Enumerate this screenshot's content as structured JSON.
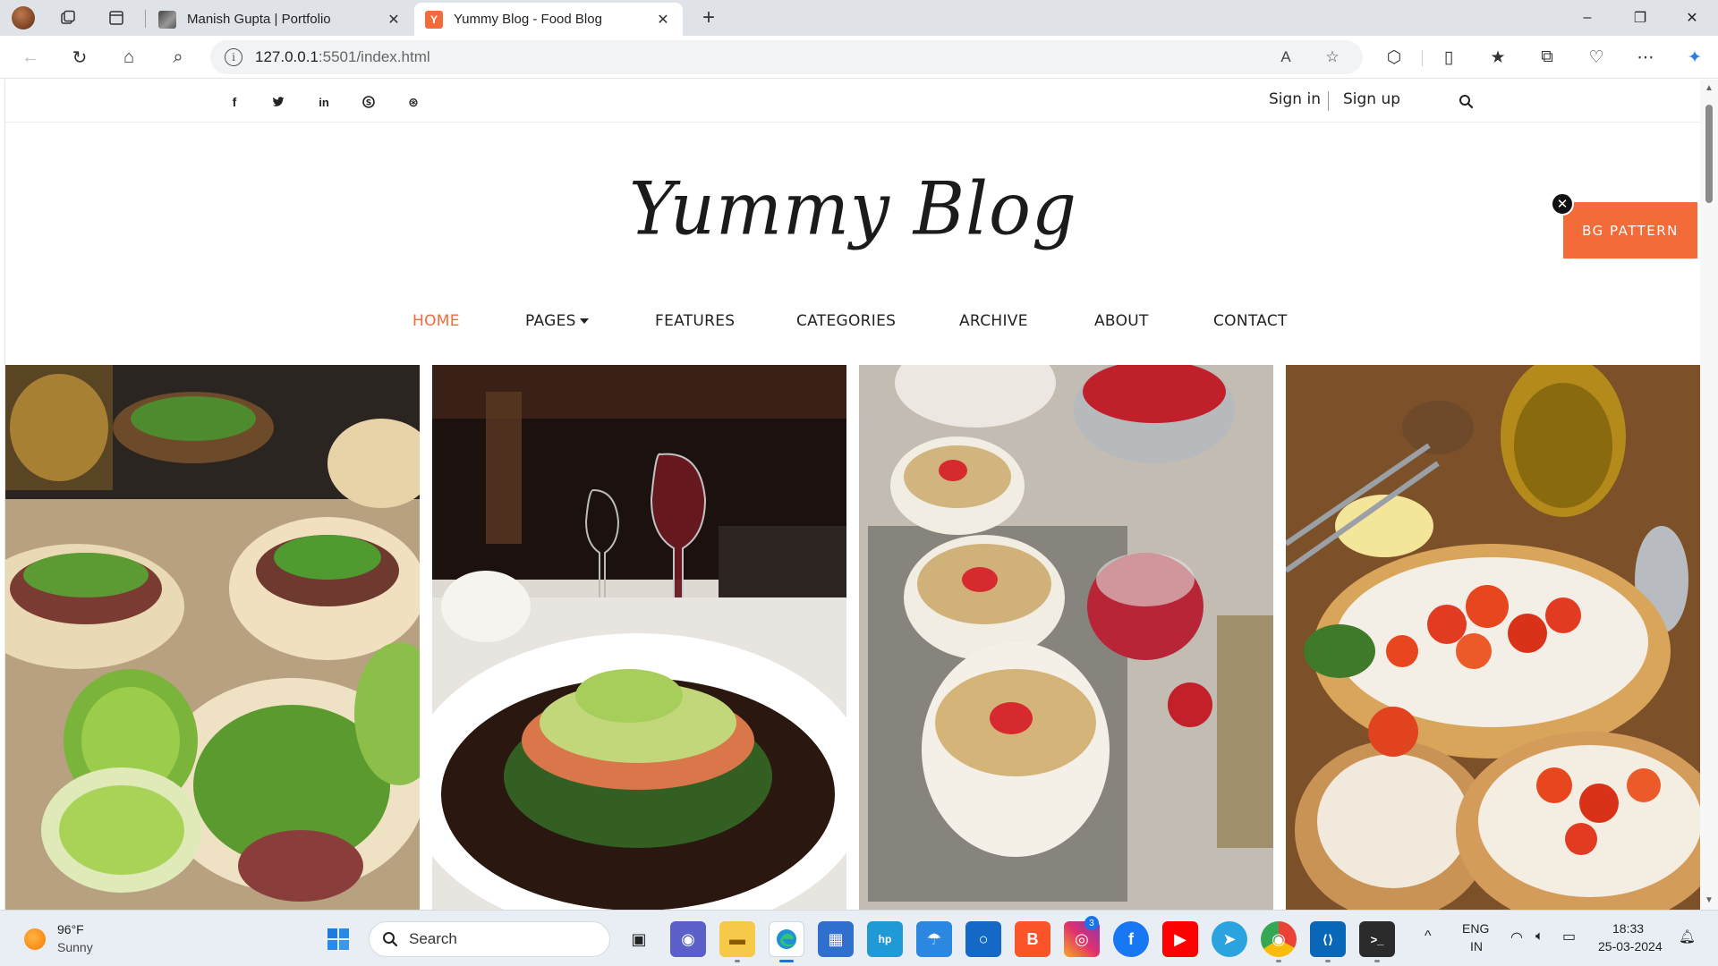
{
  "browser": {
    "tabs": [
      {
        "title": "Manish Gupta | Portfolio",
        "active": false
      },
      {
        "title": "Yummy Blog - Food Blog",
        "active": true,
        "favicon_letter": "Y"
      }
    ],
    "url": {
      "host": "127.0.0.1",
      "path": ":5501/index.html"
    },
    "new_tab_glyph": "+",
    "icons": {
      "window_min": "–",
      "window_max": "❐",
      "window_close": "✕",
      "back": "←",
      "refresh": "↻",
      "home": "⌂",
      "search": "⌕",
      "read_aloud": "A",
      "favorite": "☆",
      "extensions": "⬡",
      "split": "▯",
      "favorites_list": "★",
      "collections": "⧉",
      "browser_essentials": "♡",
      "more": "⋯",
      "copilot": "✦",
      "tab_close": "✕",
      "info": "i"
    }
  },
  "site": {
    "social": [
      {
        "name": "facebook",
        "glyph": "f"
      },
      {
        "name": "twitter",
        "glyph": "t"
      },
      {
        "name": "linkedin",
        "glyph": "in"
      },
      {
        "name": "skype",
        "glyph": "S"
      },
      {
        "name": "dribbble",
        "glyph": "⊛"
      }
    ],
    "auth": {
      "sign_in": "Sign in",
      "sign_up": "Sign up"
    },
    "logo": "Yummy Blog",
    "bg_pattern": {
      "label": "BG PATTERN",
      "close": "✕"
    },
    "nav": [
      {
        "label": "HOME",
        "active": true
      },
      {
        "label": "PAGES",
        "dropdown": true
      },
      {
        "label": "FEATURES"
      },
      {
        "label": "CATEGORIES"
      },
      {
        "label": "ARCHIVE"
      },
      {
        "label": "ABOUT"
      },
      {
        "label": "CONTACT"
      }
    ],
    "accent": "#f26b38",
    "gallery": [
      {
        "subject": "tacos-with-lime"
      },
      {
        "subject": "salmon-with-wine"
      },
      {
        "subject": "oat-parfait-strawberries"
      },
      {
        "subject": "bruschetta-tomatoes"
      }
    ]
  },
  "taskbar": {
    "weather": {
      "temp": "96°F",
      "desc": "Sunny"
    },
    "search": {
      "label": "Search"
    },
    "instagram_badge": "3",
    "tray": {
      "lang1": "ENG",
      "lang2": "IN",
      "time": "18:33",
      "date": "25-03-2024"
    },
    "icons": {
      "chevron_up": "^",
      "wifi": "◠",
      "speaker": "🔈︎",
      "battery": "▭",
      "bell": "🔔︎",
      "start": "⊞",
      "search": "⌕",
      "task_view": "▣",
      "meet": "◉",
      "explorer": "▬",
      "edge": "e",
      "store": "▦",
      "hp": "hp",
      "weather_app": "☂",
      "cortana": "○",
      "brave": "B",
      "instagram": "◎",
      "facebook": "f",
      "youtube": "▶",
      "telegram": "➤",
      "chrome": "◉",
      "vscode": "⟨⟩",
      "terminal": ">_"
    }
  }
}
